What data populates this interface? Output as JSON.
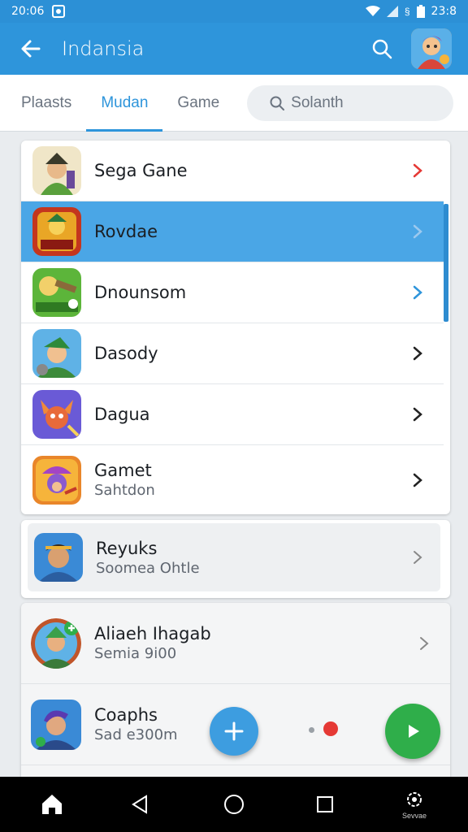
{
  "status_bar": {
    "time_left": "20:06",
    "time_right": "23:8"
  },
  "app_bar": {
    "title": "Indansia"
  },
  "tabs": [
    {
      "label": "Plaasts",
      "active": false
    },
    {
      "label": "Mudan",
      "active": true
    },
    {
      "label": "Game",
      "active": false
    }
  ],
  "search": {
    "placeholder": "Solanth"
  },
  "list": [
    {
      "title": "Sega Gane",
      "subtitle": "",
      "selected": false,
      "chevron_color": "#e53935"
    },
    {
      "title": "Rovdae",
      "subtitle": "",
      "selected": true,
      "chevron_color": "#9cc9ef"
    },
    {
      "title": "Dnounsom",
      "subtitle": "",
      "selected": false,
      "chevron_color": "#2e95db"
    },
    {
      "title": "Dasody",
      "subtitle": "",
      "selected": false,
      "chevron_color": "#222222"
    },
    {
      "title": "Dagua",
      "subtitle": "",
      "selected": false,
      "chevron_color": "#222222"
    },
    {
      "title": "Gamet",
      "subtitle": "Sahtdon",
      "selected": false,
      "chevron_color": "#222222"
    }
  ],
  "featured": {
    "title": "Reyuks",
    "subtitle": "Soomea Ohtle"
  },
  "bottom_list": [
    {
      "title": "Aliaeh Ihagab",
      "subtitle": "Semia 9i00"
    },
    {
      "title": "Coaphs",
      "subtitle": "Sad e300m"
    }
  ],
  "nav": {
    "settings_caption": "Sevvae"
  },
  "colors": {
    "primary": "#2e95db",
    "selected_row": "#4aa6e6",
    "play_fab": "#2fae4a",
    "red_dot": "#e53935"
  }
}
